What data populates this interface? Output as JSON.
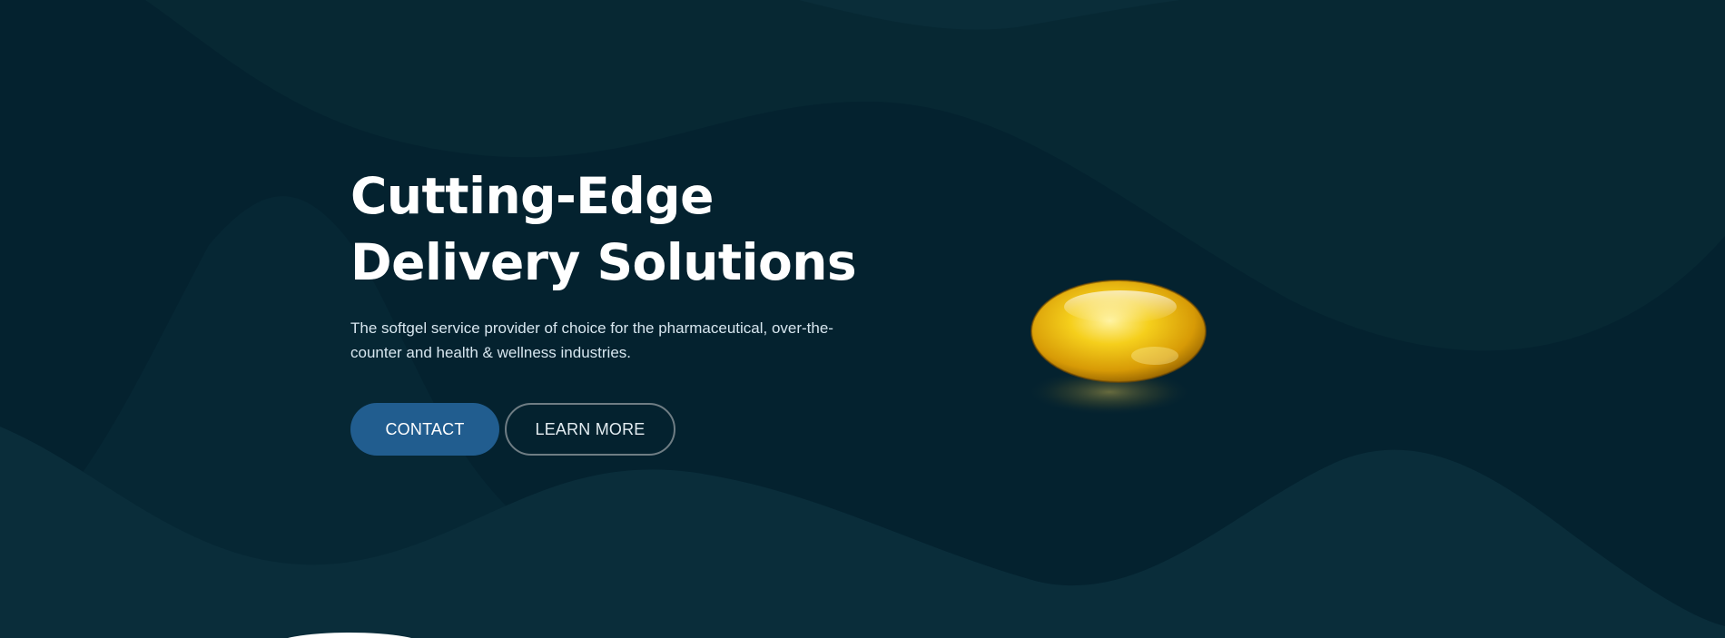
{
  "hero": {
    "headline_line1": "Cutting-Edge",
    "headline_line2": "Delivery Solutions",
    "subtitle": "The softgel service provider of choice for the pharmaceutical, over-the-counter and health & wellness industries.",
    "buttons": {
      "contact_label": "CONTACT",
      "learn_more_label": "LEARN MORE"
    },
    "image": {
      "icon": "softgel-capsule"
    }
  },
  "colors": {
    "background": "#04222f",
    "wave_light": "#0a2d3a",
    "primary_button": "#215d8f",
    "outline_border": "#6f7d84",
    "capsule_gold": "#f2c21a"
  }
}
